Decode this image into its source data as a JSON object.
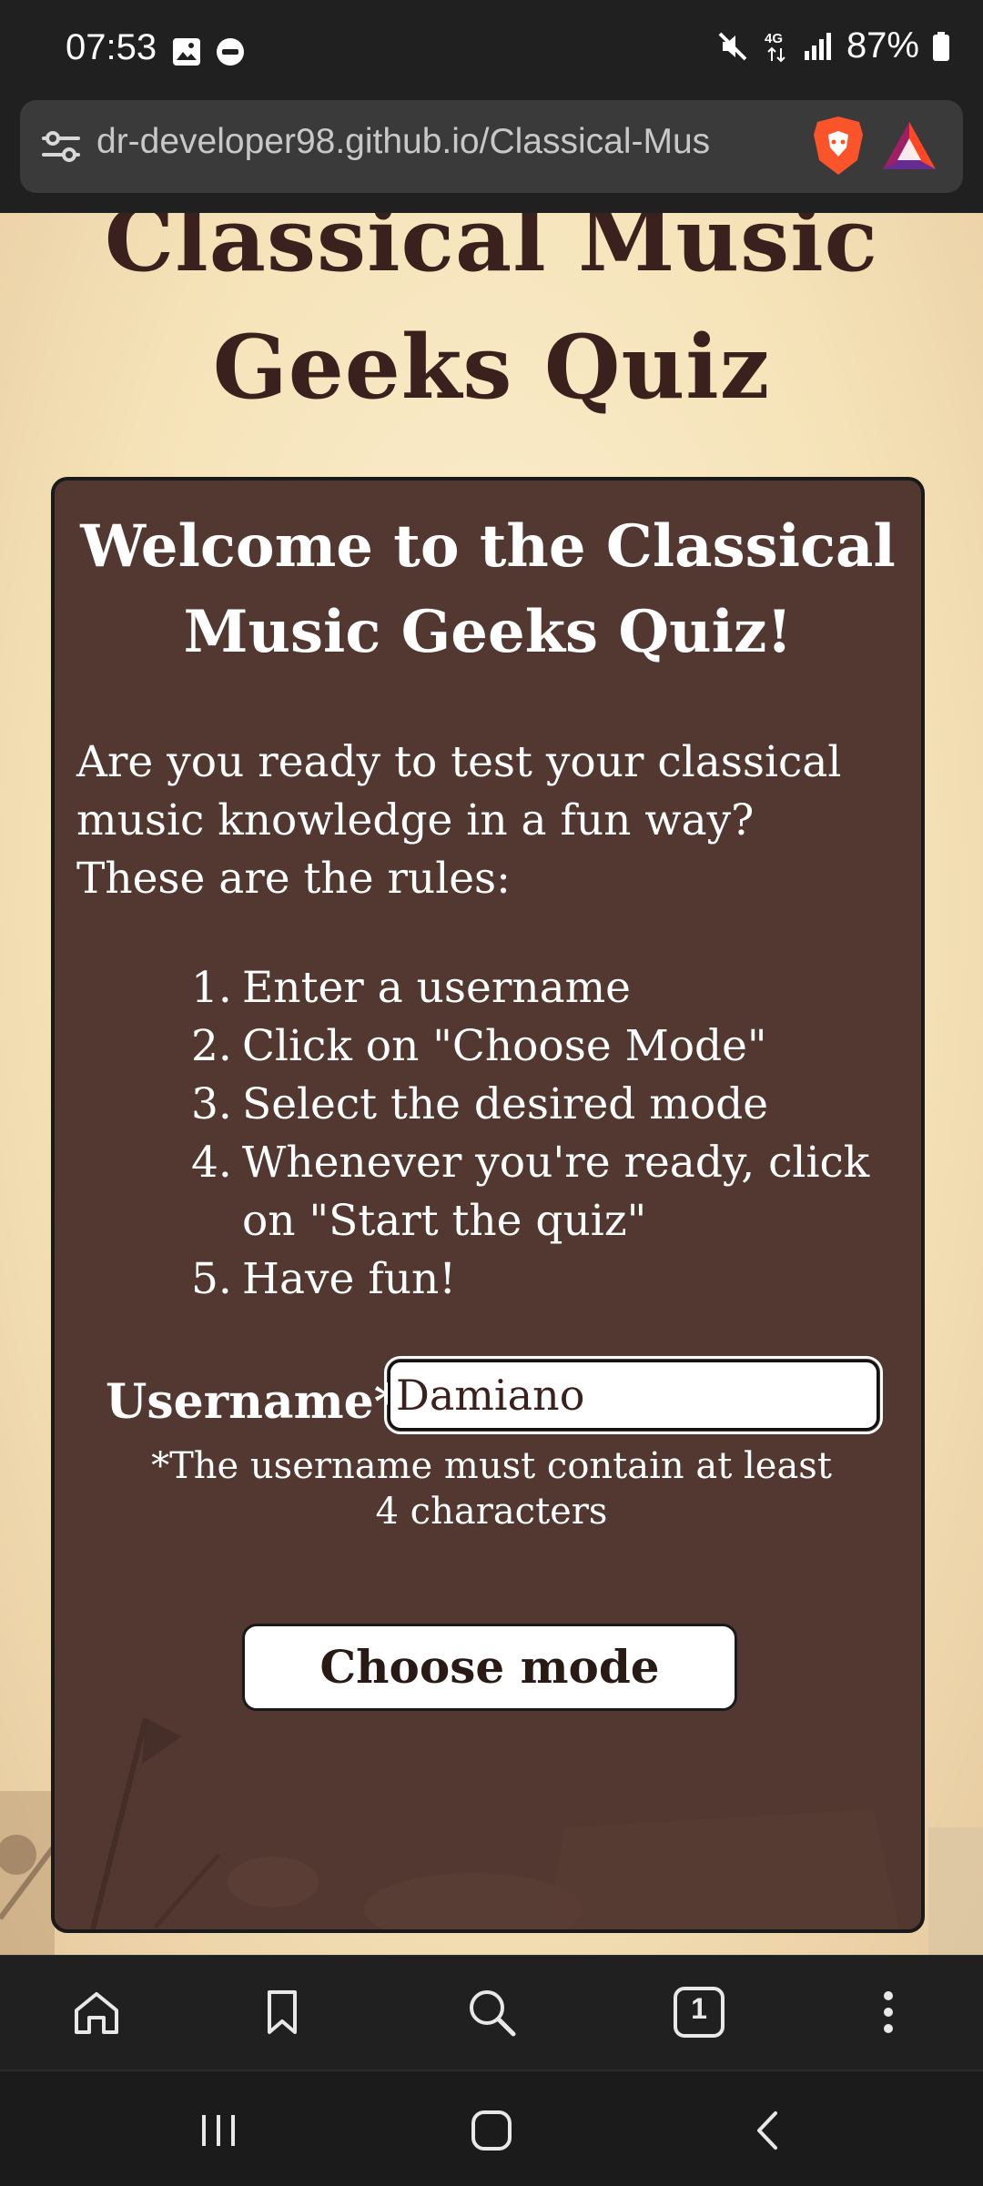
{
  "status_bar": {
    "time": "07:53",
    "battery": "87%",
    "left_icons": [
      "gallery-icon",
      "do-not-disturb-icon"
    ],
    "right_icons": [
      "mute-icon",
      "4g-icon",
      "signal-icon",
      "battery-icon"
    ]
  },
  "browser": {
    "url": "dr-developer98.github.io/Classical-Mus",
    "tab_count": "1",
    "icons": [
      "site-settings-icon",
      "brave-shields-icon",
      "bat-rewards-icon"
    ]
  },
  "page": {
    "site_title": "Classical Music Geeks Quiz",
    "card_title": "Welcome to the Classical Music Geeks Quiz!",
    "intro": "Are you ready to test your classical music knowledge in a fun way? These are the rules:",
    "rules": [
      {
        "num": "1.",
        "text": "Enter a username"
      },
      {
        "num": "2.",
        "text": "Click on \"Choose Mode\""
      },
      {
        "num": "3.",
        "text": "Select the desired mode"
      },
      {
        "num": "4.",
        "text": "Whenever you're ready, click on \"Start the quiz\""
      },
      {
        "num": "5.",
        "text": "Have fun!"
      }
    ],
    "username_label": "Username*:",
    "username_value": "Damiano",
    "username_hint": "*The username must contain at least 4 characters",
    "choose_mode_label": "Choose mode"
  },
  "colors": {
    "card_bg": "#523830",
    "title_text": "#3a211d",
    "page_bg": "#f5e2b7"
  }
}
